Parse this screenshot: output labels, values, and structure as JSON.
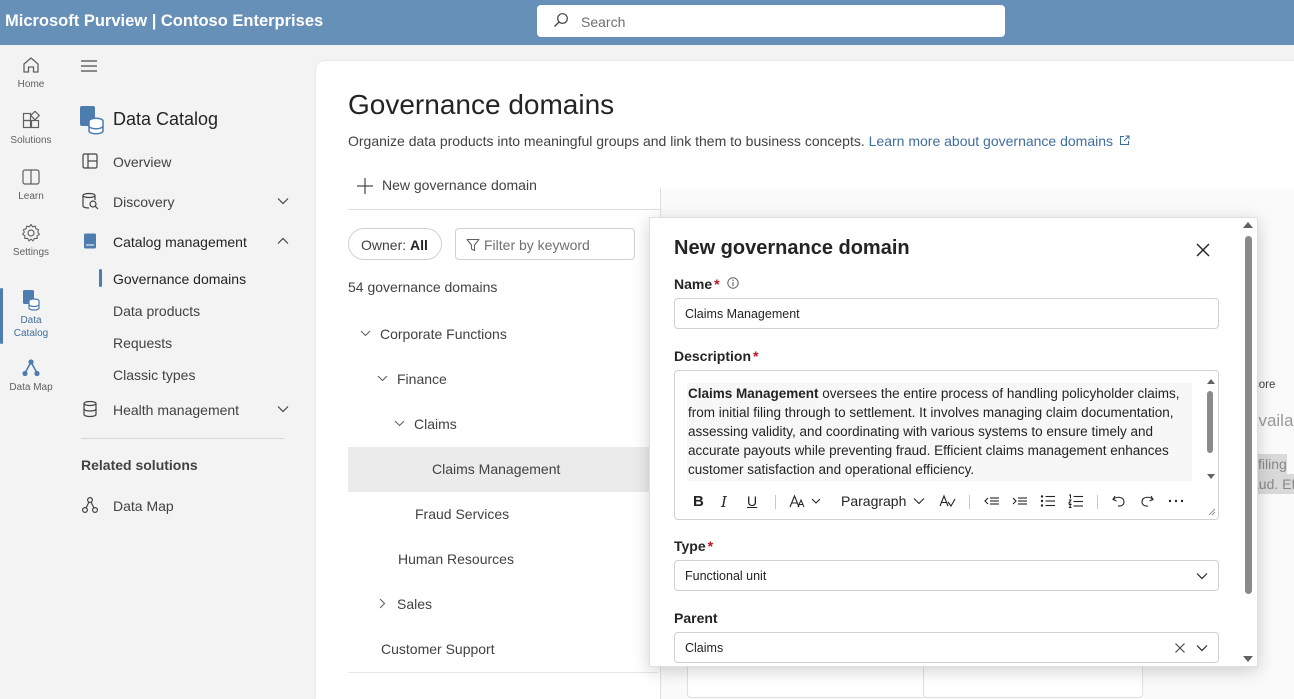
{
  "app": {
    "title": "Microsoft Purview | Contoso Enterprises",
    "search_placeholder": "Search"
  },
  "rail": {
    "items": [
      {
        "label": "Home",
        "icon": "home-icon"
      },
      {
        "label": "Solutions",
        "icon": "solutions-icon"
      },
      {
        "label": "Learn",
        "icon": "learn-icon"
      },
      {
        "label": "Settings",
        "icon": "settings-icon"
      },
      {
        "label": "Data Catalog",
        "icon": "data-catalog-icon"
      },
      {
        "label": "Data Map",
        "icon": "data-map-icon"
      }
    ]
  },
  "nav": {
    "title": "Data Catalog",
    "items": {
      "overview": "Overview",
      "discovery": "Discovery",
      "catalog_management": "Catalog management",
      "health_management": "Health management"
    },
    "sub_items": [
      "Governance domains",
      "Data products",
      "Requests",
      "Classic types"
    ],
    "related_title": "Related solutions",
    "related_item": "Data Map"
  },
  "main": {
    "title": "Governance domains",
    "description": "Organize data products into meaningful groups and link them to business concepts.",
    "learn_more": "Learn more about governance domains",
    "new_button": "New governance domain",
    "owner_label": "Owner:",
    "owner_value": "All",
    "filter_placeholder": "Filter by keyword",
    "count": "54 governance domains",
    "tree": [
      {
        "label": "Corporate Functions",
        "level": 0,
        "expander": "collapse"
      },
      {
        "label": "Finance",
        "level": 1,
        "expander": "collapse"
      },
      {
        "label": "Claims",
        "level": 2,
        "expander": "collapse"
      },
      {
        "label": "Claims Management",
        "level": 3,
        "expander": "none"
      },
      {
        "label": "Fraud Services",
        "level": 2,
        "expander": "none"
      },
      {
        "label": "Human Resources",
        "level": 1,
        "expander": "none"
      },
      {
        "label": "Sales",
        "level": 1,
        "expander": "expand"
      },
      {
        "label": "Customer Support",
        "level": 0,
        "expander": "none"
      }
    ],
    "background_fragments": [
      "core",
      "availab",
      "l filing",
      "aud. Ef"
    ]
  },
  "dialog": {
    "title": "New governance domain",
    "name_label": "Name",
    "name_value": "Claims Management",
    "description_label": "Description",
    "description_bold": "Claims Management",
    "description_rest": " oversees the entire process of handling policyholder claims, from initial filing through to settlement. It involves managing claim documentation, assessing validity, and coordinating with various systems to ensure timely and accurate payouts while preventing fraud. Efficient claims management enhances customer satisfaction and operational efficiency.",
    "toolbar": {
      "paragraph": "Paragraph"
    },
    "type_label": "Type",
    "type_value": "Functional unit",
    "parent_label": "Parent",
    "parent_value": "Claims",
    "required_mark": "*"
  }
}
